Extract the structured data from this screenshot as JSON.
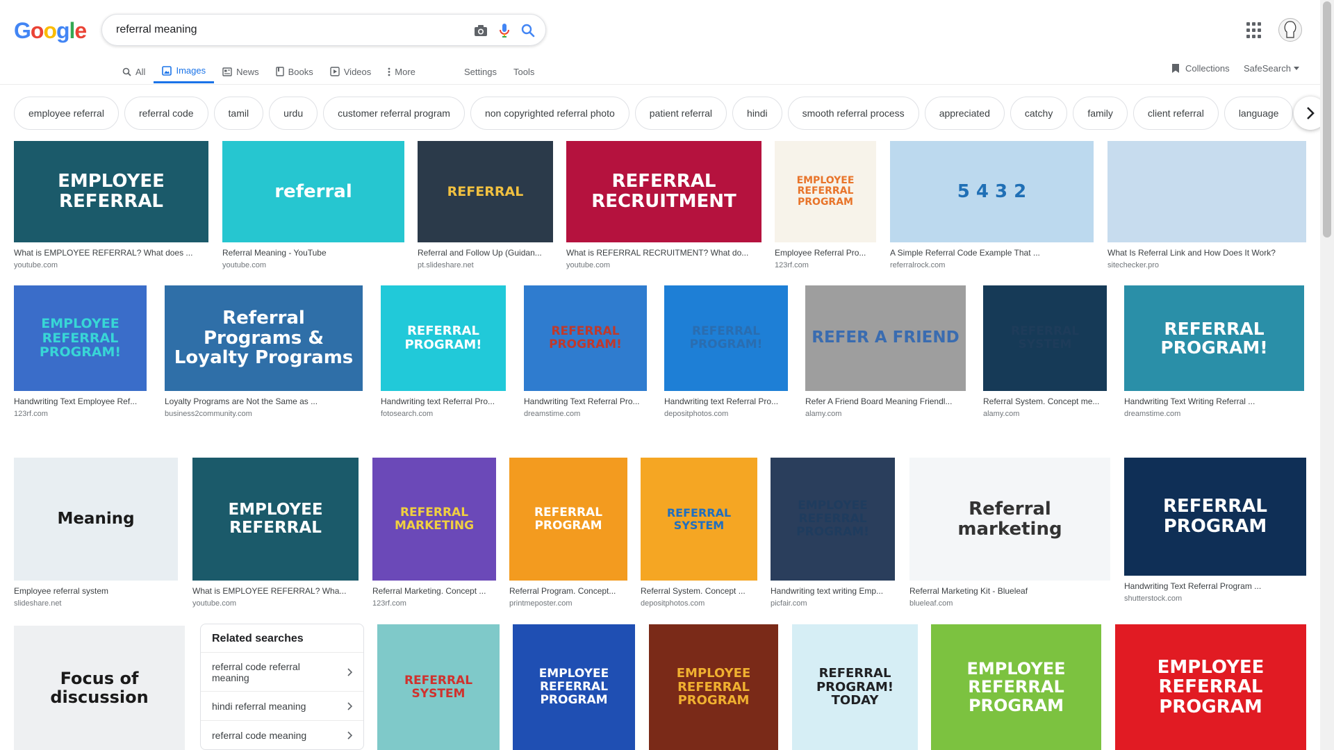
{
  "header": {
    "search_query": "referral meaning"
  },
  "tabs": [
    {
      "label": "All",
      "icon": "search-icon"
    },
    {
      "label": "Images",
      "icon": "image-icon",
      "active": true
    },
    {
      "label": "News",
      "icon": "news-icon"
    },
    {
      "label": "Books",
      "icon": "book-icon"
    },
    {
      "label": "Videos",
      "icon": "video-icon"
    },
    {
      "label": "More",
      "icon": "more-vert-icon"
    }
  ],
  "tools": {
    "settings": "Settings",
    "tools": "Tools",
    "collections": "Collections",
    "safesearch": "SafeSearch"
  },
  "chips": [
    "employee referral",
    "referral code",
    "tamil",
    "urdu",
    "customer referral program",
    "non copyrighted referral photo",
    "patient referral",
    "hindi",
    "smooth referral process",
    "appreciated",
    "catchy",
    "family",
    "client referral",
    "language"
  ],
  "results": [
    {
      "title": "What is EMPLOYEE REFERRAL? What does ...",
      "source": "youtube.com",
      "thumb_text": "EMPLOYEE REFERRAL",
      "bg": "#1b5a6a",
      "fg": "#ffffff"
    },
    {
      "title": "Referral Meaning - YouTube",
      "source": "youtube.com",
      "thumb_text": "referral",
      "bg": "#26c6d0",
      "fg": "#ffffff"
    },
    {
      "title": "Referral and Follow Up (Guidan...",
      "source": "pt.slideshare.net",
      "thumb_text": "REFERRAL",
      "bg": "#2b3a4a",
      "fg": "#f0c040"
    },
    {
      "title": "What is REFERRAL RECRUITMENT? What do...",
      "source": "youtube.com",
      "thumb_text": "REFERRAL RECRUITMENT",
      "bg": "#b5123e",
      "fg": "#ffffff"
    },
    {
      "title": "Employee Referral Pro...",
      "source": "123rf.com",
      "thumb_text": "EMPLOYEE REFERRAL PROGRAM",
      "bg": "#f7f3ea",
      "fg": "#e8742a"
    },
    {
      "title": "A Simple Referral Code Example That ...",
      "source": "referralrock.com",
      "thumb_text": "5 4 3 2",
      "bg": "#bcd9ee",
      "fg": "#1f6fb5"
    },
    {
      "title": "What Is Referral Link and How Does It Work?",
      "source": "sitechecker.pro",
      "thumb_text": "",
      "bg": "#c7dcee",
      "fg": "#4a6c8c"
    },
    {
      "title": "Handwriting Text Employee Ref...",
      "source": "123rf.com",
      "thumb_text": "EMPLOYEE REFERRAL PROGRAM!",
      "bg": "#3a6dc9",
      "fg": "#38d6d6"
    },
    {
      "title": "Loyalty Programs are Not the Same as ...",
      "source": "business2community.com",
      "thumb_text": "Referral Programs & Loyalty Programs",
      "bg": "#2f6fa8",
      "fg": "#ffffff"
    },
    {
      "title": "Handwriting text Referral Pro...",
      "source": "fotosearch.com",
      "thumb_text": "REFERRAL PROGRAM!",
      "bg": "#21c9d9",
      "fg": "#ffffff"
    },
    {
      "title": "Handwriting Text Referral Pro...",
      "source": "dreamstime.com",
      "thumb_text": "REFERRAL PROGRAM!",
      "bg": "#2f7ccf",
      "fg": "#c0392b"
    },
    {
      "title": "Handwriting text Referral Pro...",
      "source": "depositphotos.com",
      "thumb_text": "REFERRAL PROGRAM!",
      "bg": "#1e7fd6",
      "fg": "#2a6db0"
    },
    {
      "title": "Refer A Friend Board Meaning Friendl...",
      "source": "alamy.com",
      "thumb_text": "REFER A FRIEND",
      "bg": "#9e9e9e",
      "fg": "#3a6cb0"
    },
    {
      "title": "Referral System. Concept me...",
      "source": "alamy.com",
      "thumb_text": "REFERRAL SYSTEM",
      "bg": "#163a57",
      "fg": "#1e3c5a"
    },
    {
      "title": "Handwriting Text Writing Referral ...",
      "source": "dreamstime.com",
      "thumb_text": "REFERRAL PROGRAM!",
      "bg": "#2a8fa8",
      "fg": "#ffffff"
    },
    {
      "title": "Employee referral system",
      "source": "slideshare.net",
      "thumb_text": "Meaning",
      "bg": "#e8eef2",
      "fg": "#1a1a1a"
    },
    {
      "title": "What is EMPLOYEE REFERRAL? Wha...",
      "source": "youtube.com",
      "thumb_text": "EMPLOYEE REFERRAL",
      "bg": "#1b5a6a",
      "fg": "#ffffff"
    },
    {
      "title": "Referral Marketing. Concept ...",
      "source": "123rf.com",
      "thumb_text": "REFERRAL MARKETING",
      "bg": "#6b49b8",
      "fg": "#f0d040"
    },
    {
      "title": "Referral Program. Concept...",
      "source": "printmeposter.com",
      "thumb_text": "REFERRAL PROGRAM",
      "bg": "#f39b1f",
      "fg": "#ffffff"
    },
    {
      "title": "Referral System. Concept ...",
      "source": "depositphotos.com",
      "thumb_text": "REFERRAL SYSTEM",
      "bg": "#f5a623",
      "fg": "#1f6fc0"
    },
    {
      "title": "Handwriting text writing Emp...",
      "source": "picfair.com",
      "thumb_text": "EMPLOYEE REFERRAL PROGRAM!",
      "bg": "#2a3e5c",
      "fg": "#1f3c5e"
    },
    {
      "title": "Referral Marketing Kit - Blueleaf",
      "source": "blueleaf.com",
      "thumb_text": "Referral marketing",
      "bg": "#f4f6f8",
      "fg": "#333333"
    },
    {
      "title": "Handwriting Text Referral Program ...",
      "source": "shutterstock.com",
      "thumb_text": "REFERRAL PROGRAM",
      "bg": "#0f2f56",
      "fg": "#ffffff"
    },
    {
      "title": "",
      "source": "",
      "thumb_text": "Focus of discussion",
      "bg": "#eef0f2",
      "fg": "#1a1a1a"
    },
    {
      "title": "",
      "source": "",
      "thumb_text": "REFERRAL SYSTEM",
      "bg": "#7fc9c9",
      "fg": "#d0312d"
    },
    {
      "title": "",
      "source": "",
      "thumb_text": "EMPLOYEE REFERRAL PROGRAM",
      "bg": "#1f4fb3",
      "fg": "#ffffff"
    },
    {
      "title": "",
      "source": "",
      "thumb_text": "EMPLOYEE REFERRAL PROGRAM",
      "bg": "#7a2a18",
      "fg": "#f0b030"
    },
    {
      "title": "",
      "source": "",
      "thumb_text": "REFERRAL PROGRAM! TODAY",
      "bg": "#d6eef5",
      "fg": "#202124"
    },
    {
      "title": "",
      "source": "",
      "thumb_text": "EMPLOYEE REFERRAL PROGRAM",
      "bg": "#7cc240",
      "fg": "#ffffff"
    },
    {
      "title": "",
      "source": "",
      "thumb_text": "EMPLOYEE REFERRAL PROGRAM",
      "bg": "#e11b23",
      "fg": "#ffffff"
    }
  ],
  "related_searches": {
    "title": "Related searches",
    "items": [
      "referral code referral meaning",
      "hindi referral meaning",
      "referral code meaning"
    ]
  }
}
